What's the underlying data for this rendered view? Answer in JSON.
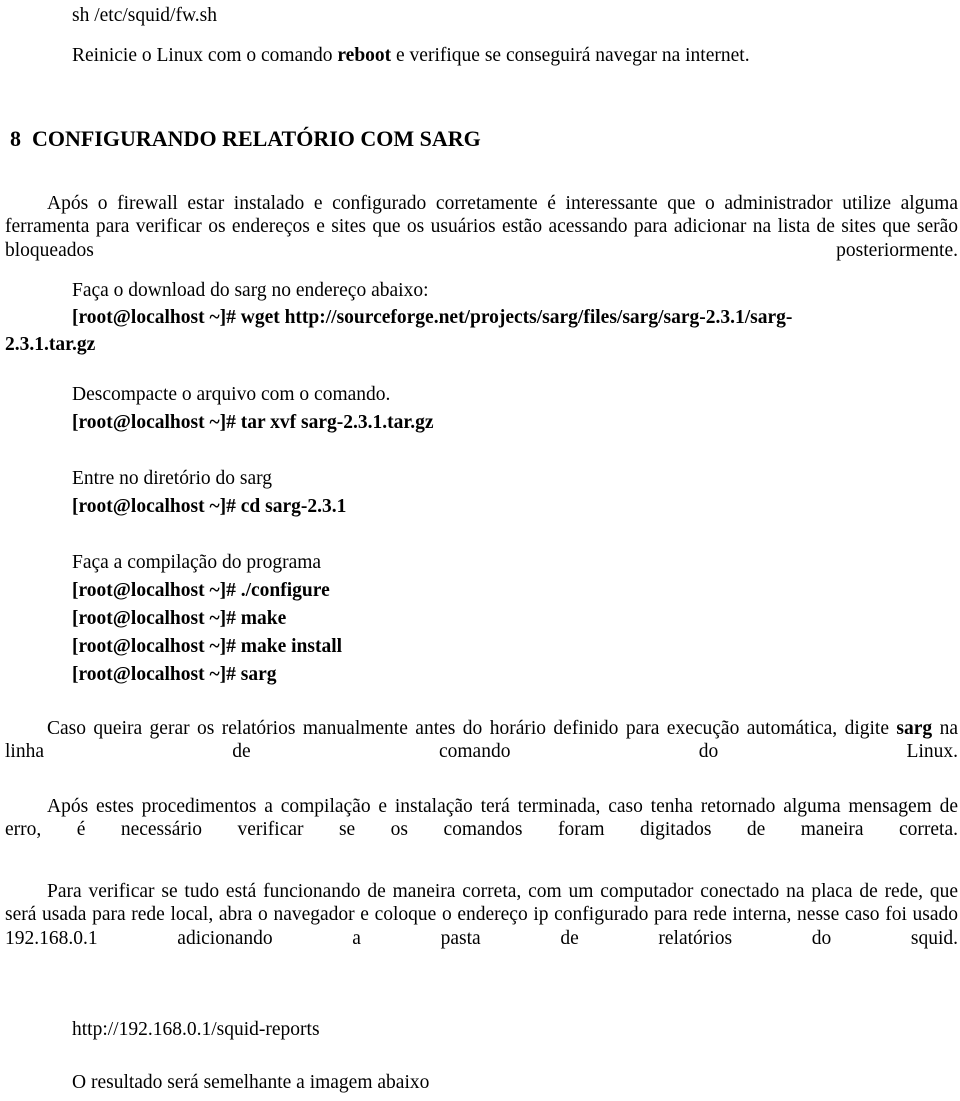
{
  "document": {
    "language": "pt-BR",
    "background_color": "#ffffff",
    "text_color": "#000000",
    "top_command": "sh /etc/squid/fw.sh",
    "intro_line": {
      "before_bold": "Reinicie o Linux com o comando ",
      "bold": "reboot",
      "after_bold": " e verifique se conseguirá navegar na internet."
    },
    "section": {
      "number": "8",
      "title": "CONFIGURANDO RELATÓRIO COM SARG"
    },
    "paragraph_1": "Após o firewall estar instalado e configurado corretamente é interessante que o administrador utilize alguma ferramenta para verificar os endereços e sites que os usuários estão acessando para adicionar na lista de sites que serão bloqueados posteriormente.",
    "download_label": "Faça o download do sarg no endereço abaixo:",
    "wget_command_line1": "[root@localhost ~]# wget http://sourceforge.net/projects/sarg/files/sarg/sarg-2.3.1/sarg-",
    "wget_command_line2": "2.3.1.tar.gz",
    "unpack_label": "Descompacte o arquivo com o comando.",
    "unpack_command": "[root@localhost ~]# tar xvf sarg-2.3.1.tar.gz",
    "enter_dir_label": "Entre no diretório do sarg",
    "enter_dir_command": "[root@localhost ~]# cd  sarg-2.3.1",
    "compile_label": "Faça a compilação do programa",
    "compile_commands": [
      "[root@localhost ~]# ./configure",
      "[root@localhost ~]# make",
      "[root@localhost ~]# make install",
      "[root@localhost ~]# sarg"
    ],
    "paragraph_2": {
      "before_bold": "Caso queira gerar os relatórios manualmente antes do horário definido para execução automática, digite ",
      "bold": "sarg",
      "after_bold": " na linha de comando do Linux."
    },
    "paragraph_3": "Após estes procedimentos a compilação e instalação terá terminada, caso tenha retornado alguma mensagem de erro, é necessário verificar se os comandos foram digitados de maneira correta.",
    "paragraph_4": "Para verificar se tudo está funcionando de maneira correta, com um computador conectado na placa de rede, que será usada para rede local, abra o navegador e coloque o endereço ip configurado para rede interna, nesse caso foi usado 192.168.0.1 adicionando a pasta de relatórios do squid.",
    "report_url": "http://192.168.0.1/squid-reports",
    "closing_line": "O resultado será semelhante a imagem abaixo"
  }
}
